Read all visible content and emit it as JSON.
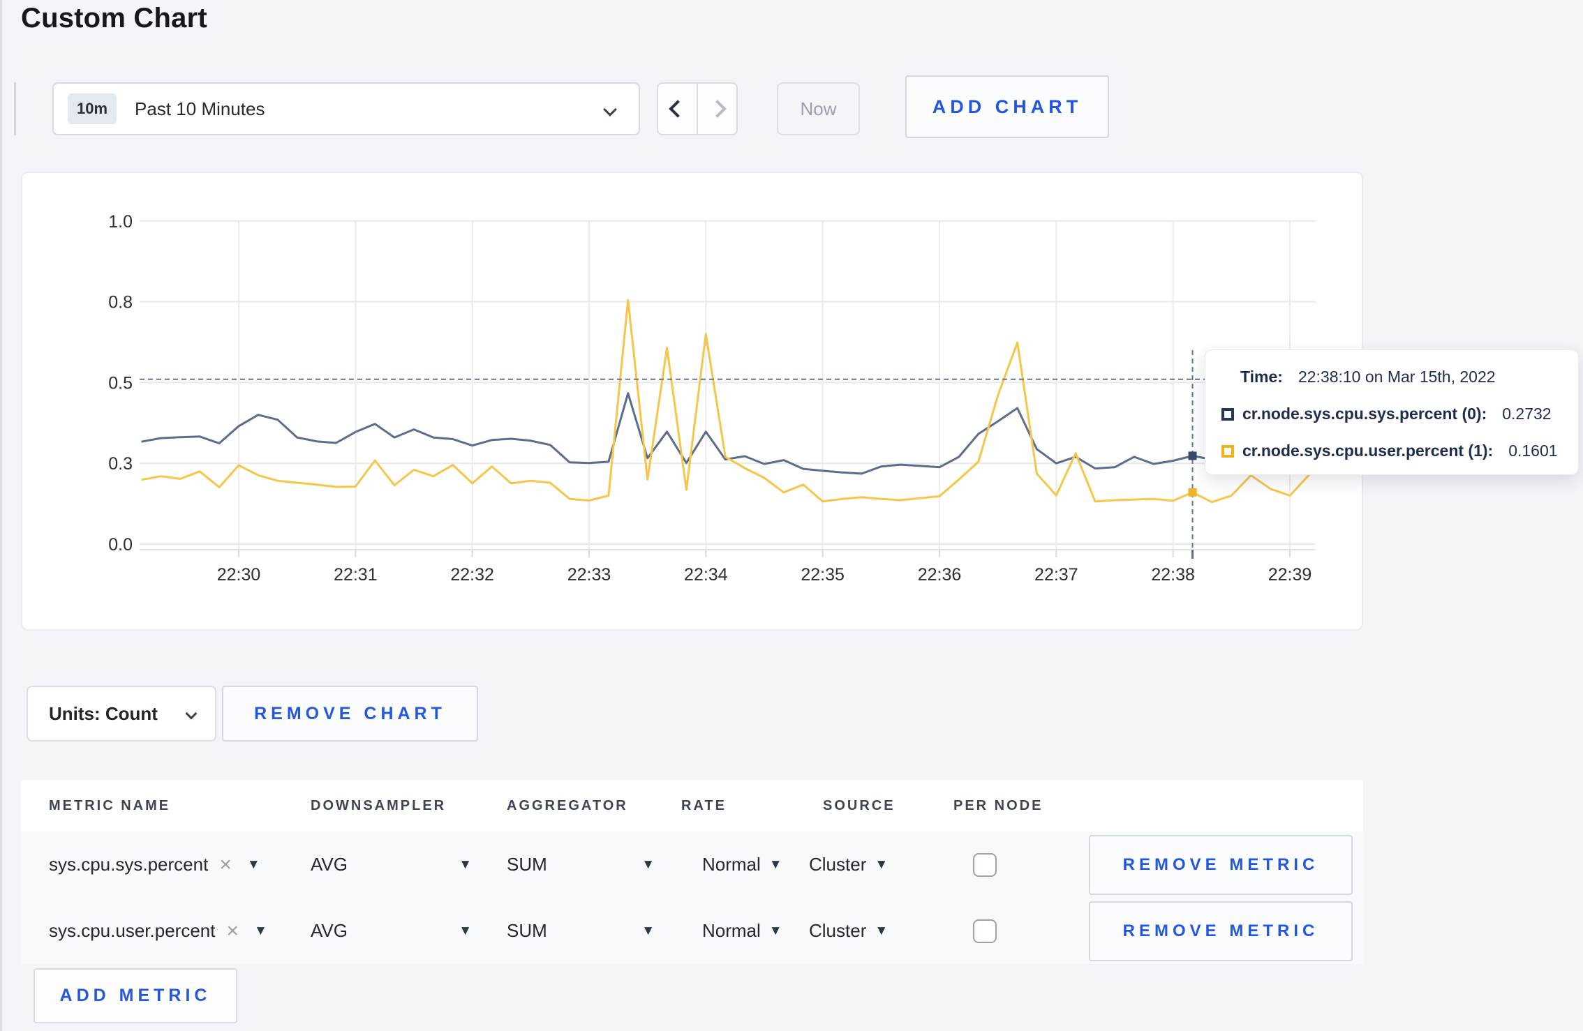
{
  "header": {
    "title": "Custom Chart"
  },
  "controls": {
    "time_range": {
      "badge": "10m",
      "label": "Past 10 Minutes"
    },
    "now_label": "Now",
    "add_chart_label": "ADD CHART"
  },
  "units": {
    "label": "Units: Count",
    "remove_chart_label": "REMOVE CHART"
  },
  "tooltip": {
    "time_title": "Time:",
    "time_value": "22:38:10 on Mar 15th, 2022",
    "entries": [
      {
        "label": "cr.node.sys.cpu.sys.percent (0):",
        "value": "0.2732",
        "color": "#24355e"
      },
      {
        "label": "cr.node.sys.cpu.user.percent (1):",
        "value": "0.1601",
        "color": "#eeb41d"
      }
    ]
  },
  "table": {
    "headers": [
      "METRIC NAME",
      "DOWNSAMPLER",
      "AGGREGATOR",
      "RATE",
      "SOURCE",
      "PER NODE"
    ],
    "rows": [
      {
        "metric": "sys.cpu.sys.percent",
        "downsampler": "AVG",
        "aggregator": "SUM",
        "rate": "Normal",
        "source": "Cluster",
        "per_node_checked": false,
        "remove_label": "REMOVE METRIC"
      },
      {
        "metric": "sys.cpu.user.percent",
        "downsampler": "AVG",
        "aggregator": "SUM",
        "rate": "Normal",
        "source": "Cluster",
        "per_node_checked": false,
        "remove_label": "REMOVE METRIC"
      }
    ],
    "add_metric_label": "ADD METRIC"
  },
  "chart_data": {
    "type": "line",
    "title": "",
    "xlabel": "",
    "ylabel": "",
    "ylim": [
      0,
      1
    ],
    "grid": true,
    "x_ticks": [
      "22:30",
      "22:31",
      "22:32",
      "22:33",
      "22:34",
      "22:35",
      "22:36",
      "22:37",
      "22:38",
      "22:39"
    ],
    "y_ticks": [
      {
        "value": 0,
        "label": "0.0"
      },
      {
        "value": 0.25,
        "label": "0.3"
      },
      {
        "value": 0.5,
        "label": "0.5"
      },
      {
        "value": 0.75,
        "label": "0.8"
      },
      {
        "value": 1,
        "label": "1.0"
      }
    ],
    "start_time": "22:29:10",
    "step_seconds": 10,
    "series": [
      {
        "name": "cr.node.sys.cpu.sys.percent",
        "color": "#5b6d8c",
        "values": [
          0.317,
          0.328,
          0.331,
          0.333,
          0.312,
          0.365,
          0.4,
          0.385,
          0.33,
          0.318,
          0.313,
          0.347,
          0.372,
          0.33,
          0.355,
          0.33,
          0.325,
          0.305,
          0.322,
          0.326,
          0.32,
          0.307,
          0.253,
          0.251,
          0.255,
          0.467,
          0.266,
          0.348,
          0.251,
          0.348,
          0.262,
          0.272,
          0.248,
          0.26,
          0.233,
          0.227,
          0.222,
          0.218,
          0.24,
          0.246,
          0.242,
          0.238,
          0.27,
          0.341,
          0.38,
          0.421,
          0.294,
          0.25,
          0.27,
          0.234,
          0.238,
          0.27,
          0.248,
          0.258,
          0.2732,
          0.262,
          0.28,
          0.3,
          0.308,
          0.295,
          0.3
        ]
      },
      {
        "name": "cr.node.sys.cpu.user.percent",
        "color": "#f6c64a",
        "values": [
          0.199,
          0.21,
          0.202,
          0.225,
          0.176,
          0.244,
          0.213,
          0.196,
          0.19,
          0.184,
          0.177,
          0.178,
          0.259,
          0.182,
          0.23,
          0.21,
          0.245,
          0.188,
          0.24,
          0.188,
          0.196,
          0.19,
          0.14,
          0.135,
          0.15,
          0.755,
          0.2,
          0.607,
          0.168,
          0.65,
          0.27,
          0.235,
          0.205,
          0.16,
          0.184,
          0.132,
          0.14,
          0.145,
          0.14,
          0.136,
          0.142,
          0.148,
          0.2,
          0.255,
          0.46,
          0.624,
          0.218,
          0.151,
          0.281,
          0.132,
          0.136,
          0.138,
          0.14,
          0.134,
          0.1601,
          0.13,
          0.15,
          0.213,
          0.171,
          0.15,
          0.215
        ]
      }
    ],
    "crosshair": {
      "time": "22:38:10",
      "hline_value": 0.51,
      "points": [
        {
          "series": 0,
          "value": 0.2732,
          "color": "#3a4a6b"
        },
        {
          "series": 1,
          "value": 0.1601,
          "color": "#f0b527"
        }
      ]
    }
  }
}
